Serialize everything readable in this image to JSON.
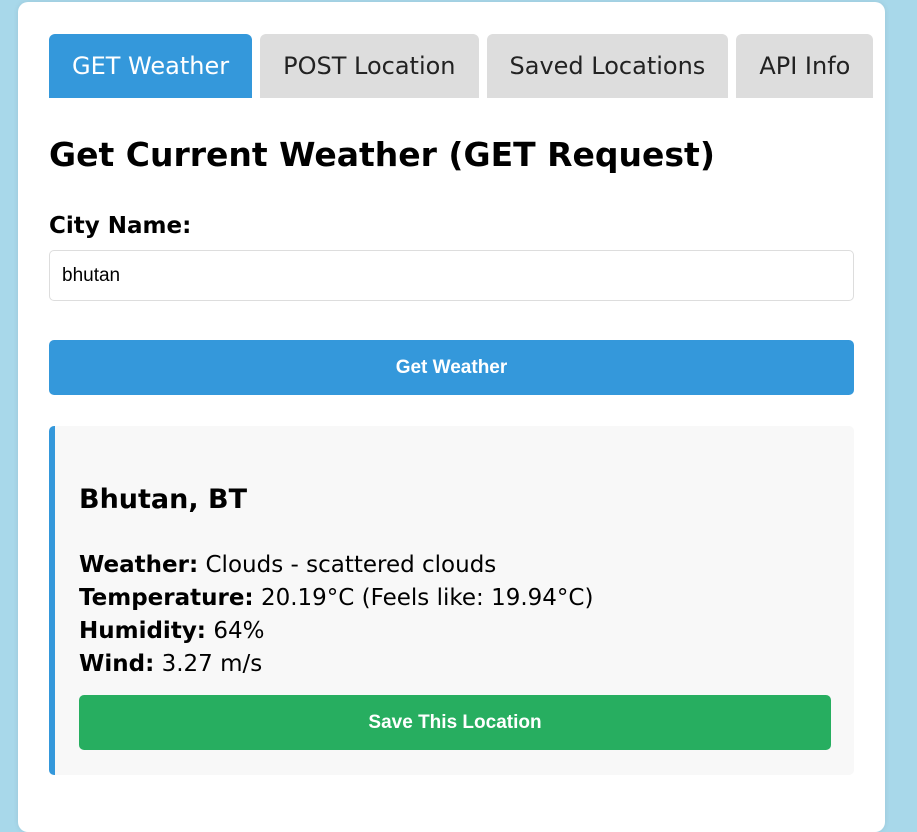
{
  "tabs": [
    {
      "label": "GET Weather",
      "active": true
    },
    {
      "label": "POST Location",
      "active": false
    },
    {
      "label": "Saved Locations",
      "active": false
    },
    {
      "label": "API Info",
      "active": false
    }
  ],
  "main": {
    "heading": "Get Current Weather (GET Request)",
    "city_label": "City Name:",
    "city_value": "bhutan",
    "get_button": "Get Weather"
  },
  "result": {
    "title": "Bhutan, BT",
    "weather_label": "Weather:",
    "weather_value": "Clouds - scattered clouds",
    "temperature_label": "Temperature:",
    "temperature_value": "20.19°C (Feels like: 19.94°C)",
    "humidity_label": "Humidity:",
    "humidity_value": "64%",
    "wind_label": "Wind:",
    "wind_value": "3.27 m/s",
    "save_button": "Save This Location"
  },
  "colors": {
    "accent": "#3498db",
    "success": "#27ae60",
    "tab_inactive": "#dddddd",
    "page_background": "#a8d8ea"
  }
}
